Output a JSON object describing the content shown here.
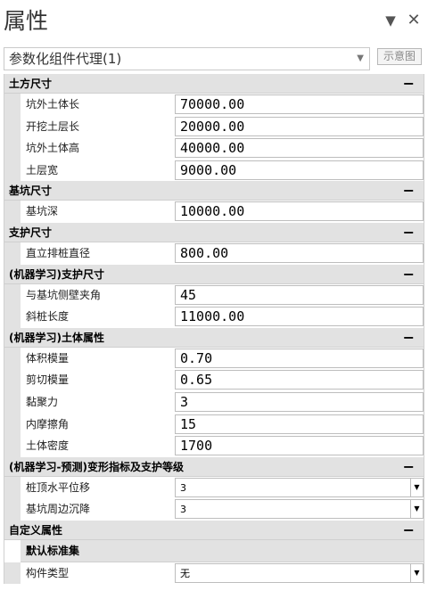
{
  "panel": {
    "title": "属性",
    "dropdown_icon": "▼",
    "close_icon": "✕"
  },
  "selector": {
    "value": "参数化组件代理(1)",
    "arrow": "▼",
    "diagram_label": "示意图"
  },
  "categories": [
    {
      "label": "土方尺寸",
      "toggle": "−",
      "rows": [
        {
          "label": "坑外土体长",
          "value": "70000.00"
        },
        {
          "label": "开挖土层长",
          "value": "20000.00"
        },
        {
          "label": "坑外土体高",
          "value": "40000.00"
        },
        {
          "label": "土层宽",
          "value": "9000.00"
        }
      ]
    },
    {
      "label": "基坑尺寸",
      "toggle": "−",
      "rows": [
        {
          "label": "基坑深",
          "value": "10000.00"
        }
      ]
    },
    {
      "label": "支护尺寸",
      "toggle": "−",
      "rows": [
        {
          "label": "直立排桩直径",
          "value": "800.00"
        }
      ]
    },
    {
      "label": "(机器学习)支护尺寸",
      "toggle": "−",
      "rows": [
        {
          "label": "与基坑侧壁夹角",
          "value": "45"
        },
        {
          "label": "斜桩长度",
          "value": "11000.00"
        }
      ]
    },
    {
      "label": "(机器学习)土体属性",
      "toggle": "−",
      "rows": [
        {
          "label": "体积模量",
          "value": "0.70"
        },
        {
          "label": "剪切模量",
          "value": "0.65"
        },
        {
          "label": "黏聚力",
          "value": "3"
        },
        {
          "label": "内摩擦角",
          "value": "15"
        },
        {
          "label": "土体密度",
          "value": "1700"
        }
      ]
    },
    {
      "label": "(机器学习-预测)变形指标及支护等级",
      "toggle": "−",
      "rows": [
        {
          "label": "桩顶水平位移",
          "value": "3",
          "combo": true
        },
        {
          "label": "基坑周边沉降",
          "value": "3",
          "combo": true
        }
      ]
    }
  ],
  "custom": {
    "label": "自定义属性",
    "toggle": "−",
    "subcategory": "默认标准集",
    "rows": [
      {
        "label": "构件类型",
        "value": "无",
        "combo": true
      }
    ]
  },
  "combo_arrow": "▼"
}
